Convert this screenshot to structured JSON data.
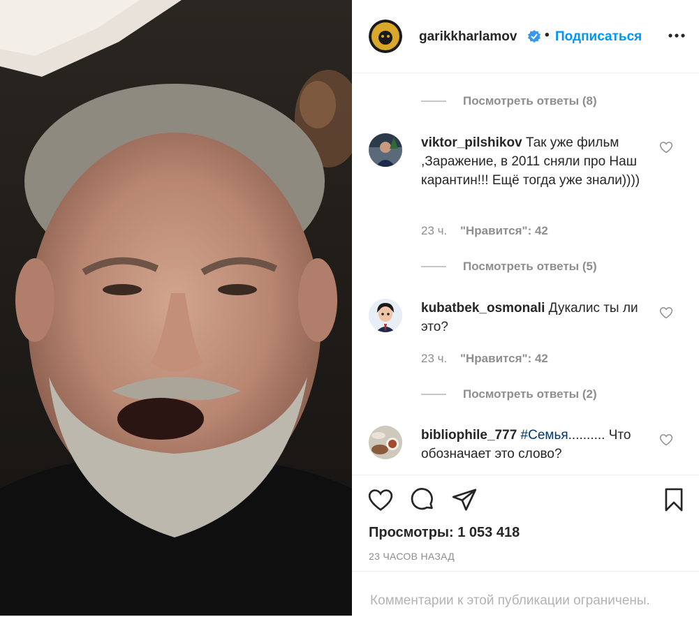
{
  "post": {
    "author": "garikkharlamov",
    "follow_label": "Подписаться",
    "separator": "•"
  },
  "comments": [
    {
      "view_replies": "Посмотреть ответы (8)"
    },
    {
      "user": "viktor_pilshikov",
      "text": "Так уже фильм ,Заражение, в 2011 сняли про Наш карантин!!! Ещё тогда уже знали))))",
      "time": "23 ч.",
      "likes": "\"Нравится\": 42",
      "view_replies": "Посмотреть ответы (5)"
    },
    {
      "user": "kubatbek_osmonali",
      "text": "Дукалис ты ли это?",
      "time": "23 ч.",
      "likes": "\"Нравится\": 42",
      "view_replies": "Посмотреть ответы (2)"
    },
    {
      "user": "bibliophile_777",
      "hashtag": "#Семья",
      "text": ".......... Что обозначает это слово?"
    }
  ],
  "stats": {
    "views_label": "Просмотры:",
    "views_value": "1 053 418",
    "time_ago": "23 ЧАСОВ НАЗАД"
  },
  "footer": {
    "comments_limited": "Комментарии к этой публикации ограничены."
  },
  "colors": {
    "accent": "#0095f6",
    "text": "#262626",
    "muted": "#8e8e8e",
    "verified": "#3897f0"
  },
  "icons": [
    "heart-icon",
    "comment-icon",
    "share-icon",
    "bookmark-icon",
    "verified-badge-icon",
    "more-options-icon"
  ]
}
